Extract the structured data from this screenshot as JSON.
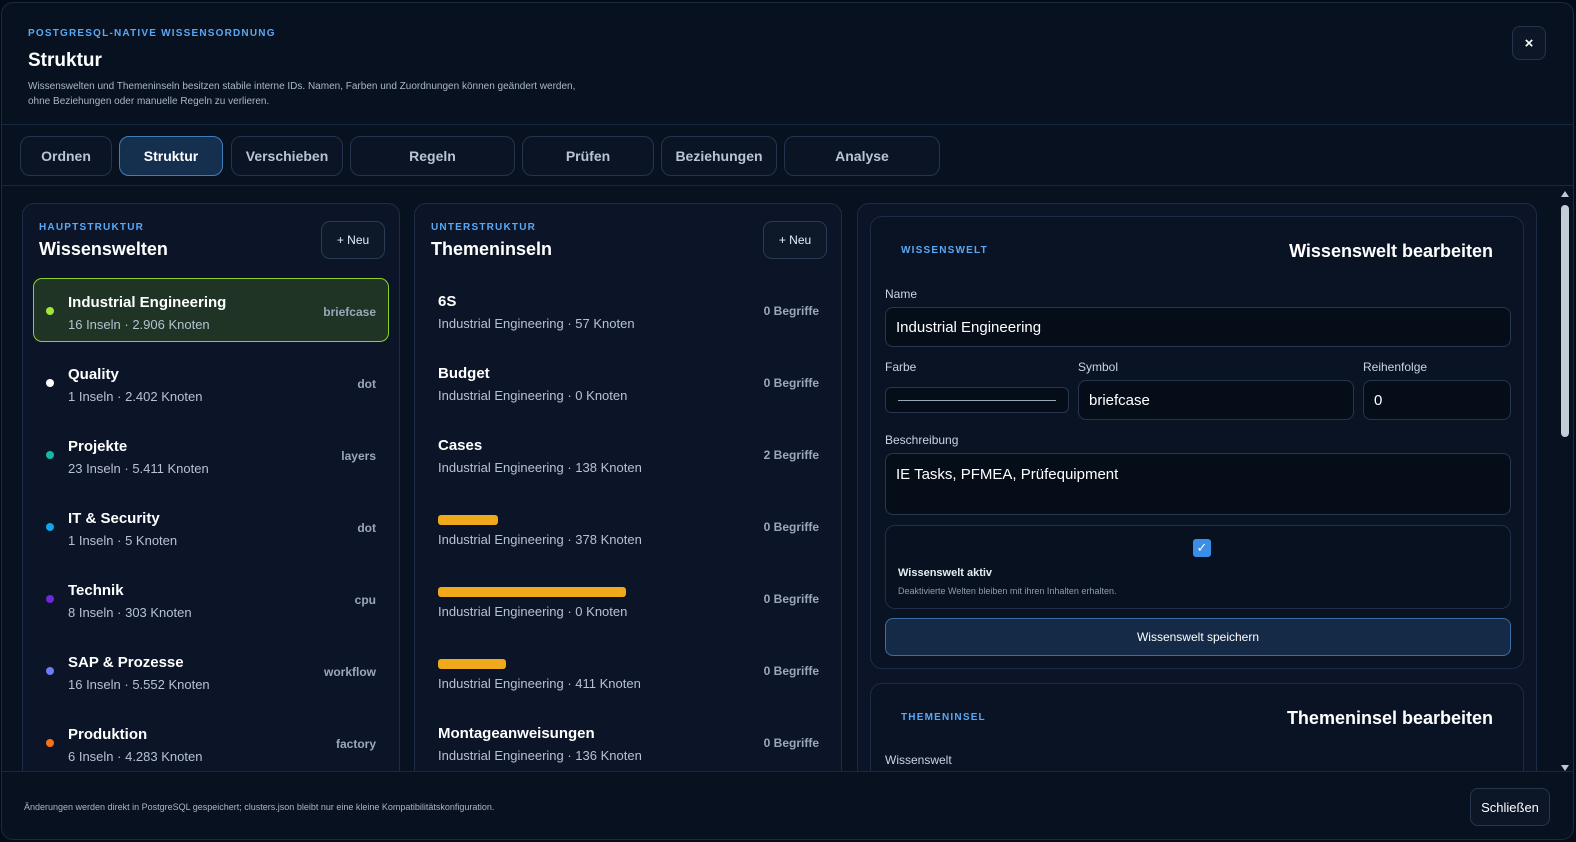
{
  "header": {
    "eyebrow": "POSTGRESQL-NATIVE WISSENSORDNUNG",
    "title": "Struktur",
    "description_line1": "Wissenswelten und Themeninseln besitzen stabile interne IDs. Namen, Farben und Zuordnungen können geändert werden,",
    "description_line2": "ohne Beziehungen oder manuelle Regeln zu verlieren.",
    "close_label": "×"
  },
  "tabs": [
    {
      "label": "Ordnen",
      "active": false
    },
    {
      "label": "Struktur",
      "active": true
    },
    {
      "label": "Verschieben",
      "active": false
    },
    {
      "label": "Regeln",
      "active": false
    },
    {
      "label": "Prüfen",
      "active": false
    },
    {
      "label": "Beziehungen",
      "active": false
    },
    {
      "label": "Analyse",
      "active": false
    }
  ],
  "worlds_panel": {
    "eyebrow": "HAUPTSTRUKTUR",
    "title": "Wissenswelten",
    "new_label": "+ Neu",
    "items": [
      {
        "name": "Industrial Engineering",
        "meta": "16 Inseln · 2.906 Knoten",
        "tag": "briefcase",
        "color": "#a3e635",
        "selected": true
      },
      {
        "name": "Quality",
        "meta": "1 Inseln · 2.402 Knoten",
        "tag": "dot",
        "color": "#ffffff",
        "selected": false
      },
      {
        "name": "Projekte",
        "meta": "23 Inseln · 5.411 Knoten",
        "tag": "layers",
        "color": "#14b8a6",
        "selected": false
      },
      {
        "name": "IT & Security",
        "meta": "1 Inseln · 5 Knoten",
        "tag": "dot",
        "color": "#0ea5e9",
        "selected": false
      },
      {
        "name": "Technik",
        "meta": "8 Inseln · 303 Knoten",
        "tag": "cpu",
        "color": "#6d28d9",
        "selected": false
      },
      {
        "name": "SAP & Prozesse",
        "meta": "16 Inseln · 5.552 Knoten",
        "tag": "workflow",
        "color": "#6b7cf5",
        "selected": false
      },
      {
        "name": "Produktion",
        "meta": "6 Inseln · 4.283 Knoten",
        "tag": "factory",
        "color": "#f97316",
        "selected": false
      }
    ]
  },
  "topics_panel": {
    "eyebrow": "UNTERSTRUKTUR",
    "title": "Themeninseln",
    "new_label": "+ Neu",
    "items": [
      {
        "name": "6S",
        "meta": "Industrial Engineering · 57 Knoten",
        "count": "0 Begriffe",
        "redacted": false
      },
      {
        "name": "Budget",
        "meta": "Industrial Engineering · 0 Knoten",
        "count": "0 Begriffe",
        "redacted": false
      },
      {
        "name": "Cases",
        "meta": "Industrial Engineering · 138 Knoten",
        "count": "2 Begriffe",
        "redacted": false
      },
      {
        "name": "",
        "meta": "Industrial Engineering · 378 Knoten",
        "count": "0 Begriffe",
        "redacted": true
      },
      {
        "name": "",
        "meta": "Industrial Engineering · 0 Knoten",
        "count": "0 Begriffe",
        "redacted": true
      },
      {
        "name": "",
        "meta": "Industrial Engineering · 411 Knoten",
        "count": "0 Begriffe",
        "redacted": true
      },
      {
        "name": "Montageanweisungen",
        "meta": "Industrial Engineering · 136 Knoten",
        "count": "0 Begriffe",
        "redacted": false
      }
    ]
  },
  "edit_world": {
    "eyebrow": "WISSENSWELT",
    "title": "Wissenswelt bearbeiten",
    "name_label": "Name",
    "name_value": "Industrial Engineering",
    "color_label": "Farbe",
    "symbol_label": "Symbol",
    "symbol_value": "briefcase",
    "order_label": "Reihenfolge",
    "order_value": "0",
    "description_label": "Beschreibung",
    "description_value": "IE Tasks, PFMEA, Prüfequipment",
    "active_label": "Wissenswelt aktiv",
    "active_hint": "Deaktivierte Welten bleiben mit ihren Inhalten erhalten.",
    "save_label": "Wissenswelt speichern"
  },
  "edit_topic": {
    "eyebrow": "THEMENINSEL",
    "title": "Themeninsel bearbeiten",
    "world_label": "Wissenswelt"
  },
  "footer": {
    "text": "Änderungen werden direkt in PostgreSQL gespeichert; clusters.json bleibt nur eine kleine Kompatibilitätskonfiguration.",
    "close_label": "Schließen"
  }
}
